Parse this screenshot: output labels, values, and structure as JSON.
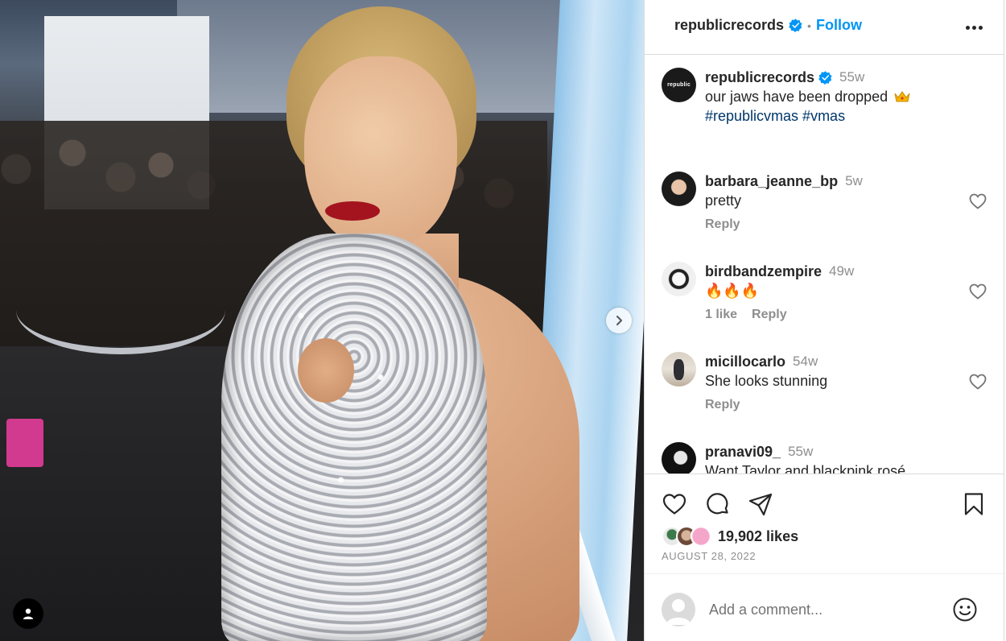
{
  "post": {
    "author": "republicrecords",
    "follow_label": "Follow",
    "separator": "•"
  },
  "caption": {
    "avatar_text": "republic",
    "username": "republicrecords",
    "time": "55w",
    "text": "our jaws have been dropped",
    "emoji": "crown",
    "hashtags": "#republicvmas #vmas"
  },
  "comments": [
    {
      "username": "barbara_jeanne_bp",
      "time": "5w",
      "text": "pretty",
      "likes": "",
      "reply": "Reply"
    },
    {
      "username": "birdbandzempire",
      "time": "49w",
      "text": "🔥🔥🔥",
      "likes": "1 like",
      "reply": "Reply"
    },
    {
      "username": "micillocarlo",
      "time": "54w",
      "text": "She looks stunning",
      "likes": "",
      "reply": "Reply"
    },
    {
      "username": "pranavi09_",
      "time": "55w",
      "text": "Want Taylor and blackpink rosé",
      "likes": "",
      "reply": ""
    }
  ],
  "engagement": {
    "likes": "19,902 likes",
    "date": "AUGUST 28, 2022"
  },
  "add_comment": {
    "placeholder": "Add a comment..."
  },
  "icons": {
    "verified": "verified-badge-icon",
    "more": "more-options-icon",
    "like": "heart-icon",
    "comment": "comment-icon",
    "share": "share-icon",
    "save": "bookmark-icon",
    "next": "chevron-right-icon",
    "tag": "user-tag-icon",
    "emoji": "smiley-icon"
  },
  "colors": {
    "accent": "#0095f6",
    "hashtag": "#00376b",
    "muted": "#8e8e8e",
    "text": "#262626",
    "border": "#dbdbdb"
  }
}
